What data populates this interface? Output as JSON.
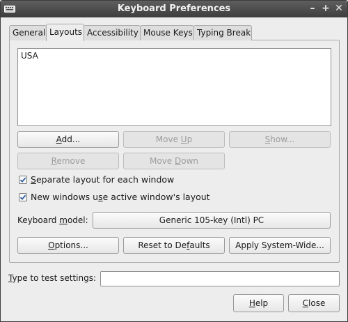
{
  "window": {
    "title": "Keyboard Preferences",
    "minimize_glyph": "–",
    "maximize_glyph": "+",
    "close_glyph": "✕"
  },
  "tabs": [
    {
      "label": "General"
    },
    {
      "label": "Layouts",
      "active": true
    },
    {
      "label": "Accessibility"
    },
    {
      "label": "Mouse Keys"
    },
    {
      "label": "Typing Break"
    }
  ],
  "layouts": {
    "items": [
      "USA"
    ],
    "add": {
      "pre": "",
      "mnemonic": "A",
      "post": "dd..."
    },
    "move_up": {
      "pre": "Move ",
      "mnemonic": "U",
      "post": "p"
    },
    "show": {
      "pre": "",
      "mnemonic": "S",
      "post": "how..."
    },
    "remove": {
      "pre": "",
      "mnemonic": "R",
      "post": "emove"
    },
    "move_down": {
      "pre": "Move ",
      "mnemonic": "D",
      "post": "own"
    },
    "separate_layout": {
      "pre": "",
      "mnemonic": "S",
      "post": "eparate layout for each window",
      "checked": true
    },
    "new_windows": {
      "pre": "New windows u",
      "mnemonic": "s",
      "post": "e active window's layout",
      "checked": true
    },
    "keyboard_model_label": {
      "pre": "Keyboard ",
      "mnemonic": "m",
      "post": "odel:"
    },
    "keyboard_model_value": "Generic 105-key (Intl) PC",
    "options": {
      "pre": "",
      "mnemonic": "O",
      "post": "ptions..."
    },
    "reset": {
      "pre": "Reset to De",
      "mnemonic": "f",
      "post": "aults"
    },
    "apply_system_wide": "Apply System-Wide..."
  },
  "test": {
    "label": {
      "pre": "",
      "mnemonic": "T",
      "post": "ype to test settings:"
    },
    "value": ""
  },
  "footer": {
    "help": {
      "pre": "",
      "mnemonic": "H",
      "post": "elp"
    },
    "close": {
      "pre": "",
      "mnemonic": "C",
      "post": "lose"
    }
  }
}
